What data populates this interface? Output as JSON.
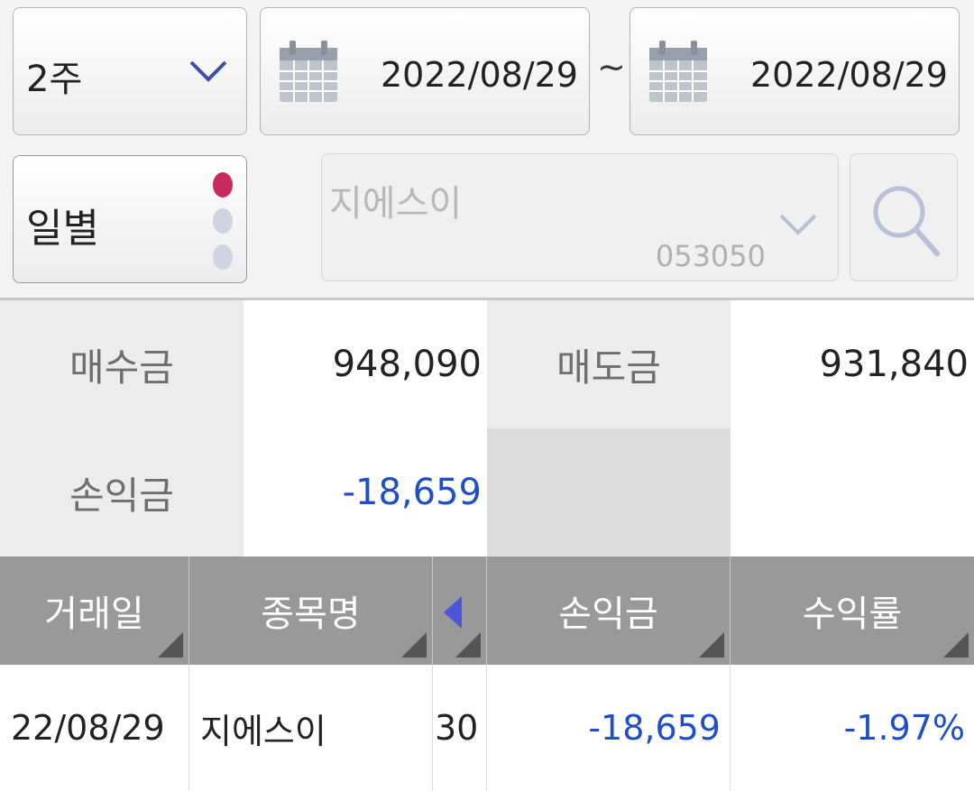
{
  "filters": {
    "period": "2주",
    "start_date": "2022/08/29",
    "range_sep": "~",
    "end_date": "2022/08/29",
    "mode": "일별",
    "stock_name": "지에스이",
    "stock_code": "053050"
  },
  "summary": {
    "buy_label": "매수금",
    "buy_value": "948,090",
    "sell_label": "매도금",
    "sell_value": "931,840",
    "pnl_label": "손익금",
    "pnl_value": "-18,659"
  },
  "table": {
    "headers": [
      "거래일",
      "종목명",
      "손익금",
      "수익률"
    ],
    "rows": [
      {
        "date": "22/08/29",
        "name": "지에스이",
        "qty": "30",
        "pnl": "-18,659",
        "rate": "-1.97%"
      }
    ]
  },
  "colors": {
    "accent_dot": "#c9295f",
    "negative": "#1f4ec7",
    "header_bg": "#999999",
    "sort_arrow": "#4b55d8"
  }
}
